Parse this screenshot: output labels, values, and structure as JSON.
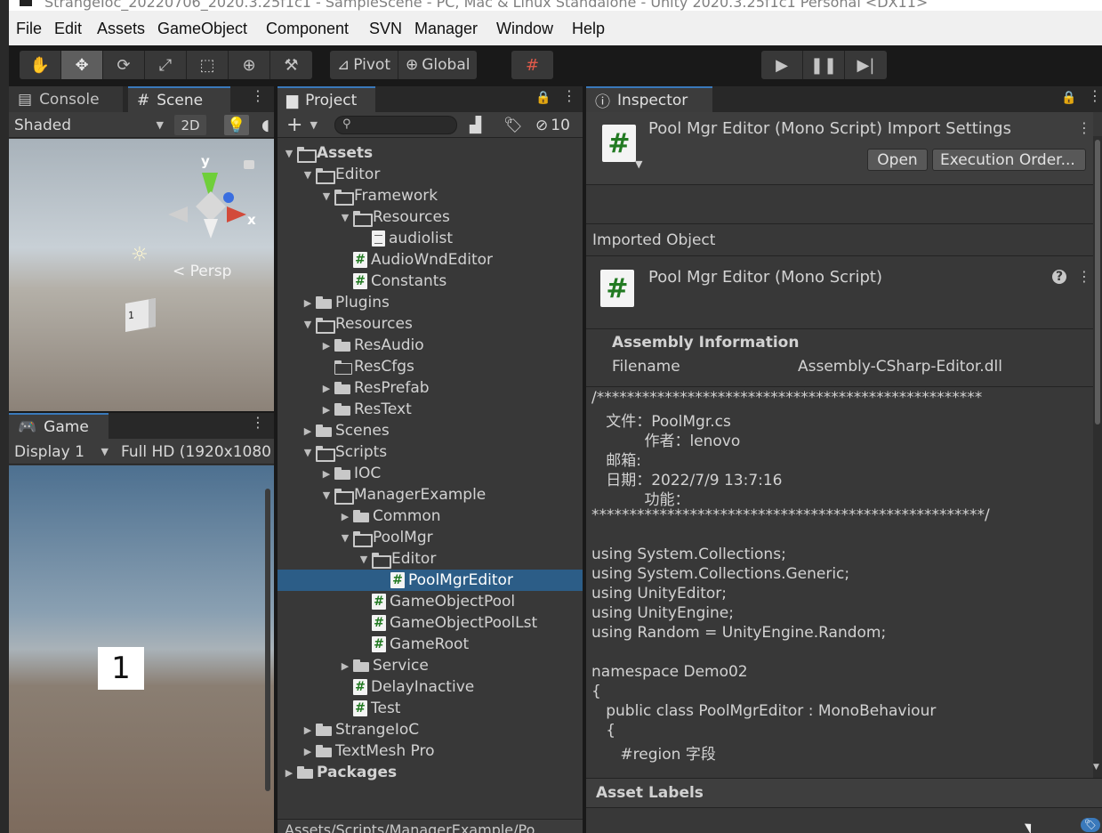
{
  "window": {
    "title": "StrangeIoc_20220706_2020.3.25f1c1 - SampleScene - PC, Mac & Linux Standalone - Unity 2020.3.25f1c1 Personal <DX11>"
  },
  "menu": [
    "File",
    "Edit",
    "Assets",
    "GameObject",
    "Component",
    "SVN",
    "Manager",
    "Window",
    "Help"
  ],
  "toolbar": {
    "tools": [
      "hand-icon",
      "move-icon",
      "rotate-icon",
      "scale-icon",
      "rect-icon",
      "transform-icon",
      "custom-tool-icon"
    ],
    "pivot_label": "Pivot",
    "global_label": "Global",
    "grid_snap": "grid-snap-icon",
    "play": "play-icon",
    "pause": "pause-icon",
    "step": "step-icon"
  },
  "scene": {
    "tabs": [
      "Console",
      "Scene"
    ],
    "shading": "Shaded",
    "mode_2d": "2D",
    "gizmo_y": "y",
    "gizmo_x": "x",
    "persp": "< Persp",
    "cube_label": "1"
  },
  "game": {
    "tab": "Game",
    "display": "Display 1",
    "resolution": "Full HD (1920x1080",
    "sign": "1"
  },
  "project": {
    "tab": "Project",
    "add": "+",
    "hidden_count": "10",
    "breadcrumb": "Assets/Scripts/ManagerExample/Po",
    "tree": [
      {
        "label": "Assets",
        "depth": 0,
        "kind": "folder-open",
        "arrow": "down",
        "bold": true
      },
      {
        "label": "Editor",
        "depth": 1,
        "kind": "folder-open",
        "arrow": "down"
      },
      {
        "label": "Framework",
        "depth": 2,
        "kind": "folder-open",
        "arrow": "down"
      },
      {
        "label": "Resources",
        "depth": 3,
        "kind": "folder-open",
        "arrow": "down"
      },
      {
        "label": "audiolist",
        "depth": 4,
        "kind": "text"
      },
      {
        "label": "AudioWndEditor",
        "depth": 3,
        "kind": "script"
      },
      {
        "label": "Constants",
        "depth": 3,
        "kind": "script"
      },
      {
        "label": "Plugins",
        "depth": 1,
        "kind": "folder",
        "arrow": "right"
      },
      {
        "label": "Resources",
        "depth": 1,
        "kind": "folder-open",
        "arrow": "down"
      },
      {
        "label": "ResAudio",
        "depth": 2,
        "kind": "folder",
        "arrow": "right"
      },
      {
        "label": "ResCfgs",
        "depth": 2,
        "kind": "folder-empty"
      },
      {
        "label": "ResPrefab",
        "depth": 2,
        "kind": "folder",
        "arrow": "right"
      },
      {
        "label": "ResText",
        "depth": 2,
        "kind": "folder",
        "arrow": "right"
      },
      {
        "label": "Scenes",
        "depth": 1,
        "kind": "folder",
        "arrow": "right"
      },
      {
        "label": "Scripts",
        "depth": 1,
        "kind": "folder-open",
        "arrow": "down"
      },
      {
        "label": "IOC",
        "depth": 2,
        "kind": "folder",
        "arrow": "right"
      },
      {
        "label": "ManagerExample",
        "depth": 2,
        "kind": "folder-open",
        "arrow": "down"
      },
      {
        "label": "Common",
        "depth": 3,
        "kind": "folder",
        "arrow": "right"
      },
      {
        "label": "PoolMgr",
        "depth": 3,
        "kind": "folder-open",
        "arrow": "down"
      },
      {
        "label": "Editor",
        "depth": 4,
        "kind": "folder-open",
        "arrow": "down"
      },
      {
        "label": "PoolMgrEditor",
        "depth": 5,
        "kind": "script",
        "selected": true
      },
      {
        "label": "GameObjectPool",
        "depth": 4,
        "kind": "script"
      },
      {
        "label": "GameObjectPoolLst",
        "depth": 4,
        "kind": "script"
      },
      {
        "label": "GameRoot",
        "depth": 4,
        "kind": "script"
      },
      {
        "label": "Service",
        "depth": 3,
        "kind": "folder",
        "arrow": "right"
      },
      {
        "label": "DelayInactive",
        "depth": 3,
        "kind": "script"
      },
      {
        "label": "Test",
        "depth": 3,
        "kind": "script"
      },
      {
        "label": "StrangeIoC",
        "depth": 1,
        "kind": "folder",
        "arrow": "right"
      },
      {
        "label": "TextMesh Pro",
        "depth": 1,
        "kind": "folder",
        "arrow": "right"
      },
      {
        "label": "Packages",
        "depth": 0,
        "kind": "folder",
        "arrow": "right",
        "bold": true
      }
    ]
  },
  "inspector": {
    "tab": "Inspector",
    "header_title": "Pool Mgr Editor (Mono Script) Import Settings",
    "open_button": "Open",
    "exec_order_button": "Execution Order...",
    "imported_object": "Imported Object",
    "object_title": "Pool Mgr Editor (Mono Script)",
    "assembly_heading": "Assembly Information",
    "filename_label": "Filename",
    "filename_value": "Assembly-CSharp-Editor.dll",
    "code_lines": [
      "/***************************************************",
      "   文件：PoolMgr.cs",
      "           作者：lenovo",
      "   邮箱:",
      "   日期：2022/7/9 13:7:16",
      "           功能：",
      "****************************************************/",
      "",
      "using System.Collections;",
      "using System.Collections.Generic;",
      "using UnityEditor;",
      "using UnityEngine;",
      "using Random = UnityEngine.Random;",
      "",
      "namespace Demo02",
      "{",
      "   public class PoolMgrEditor : MonoBehaviour",
      "   {",
      "      #region 字段"
    ],
    "asset_labels": "Asset Labels"
  },
  "colors": {
    "selection": "#2c5d87",
    "script_green": "#227a22",
    "panel_bg": "#383838",
    "scene_sky": "#b8c4cc",
    "game_sky": "#5a7a9a",
    "ground": "#7d6b5d"
  }
}
